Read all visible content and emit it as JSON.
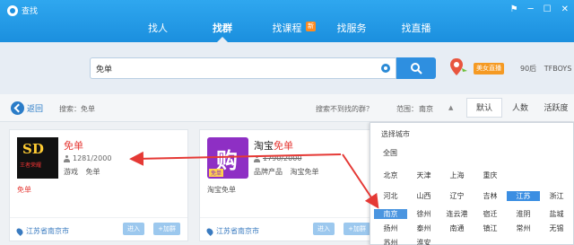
{
  "app": {
    "title": "查找"
  },
  "window_controls": [
    "⚑",
    "─",
    "☐",
    "✕"
  ],
  "nav": {
    "tabs": [
      {
        "label": "找人",
        "active": false
      },
      {
        "label": "找群",
        "active": true
      },
      {
        "label": "找课程",
        "active": false,
        "badge": "新"
      },
      {
        "label": "找服务",
        "active": false
      },
      {
        "label": "找直播",
        "active": false
      }
    ]
  },
  "search": {
    "value": "免单",
    "placeholder": ""
  },
  "header_right": {
    "live_badge": "美女直播",
    "texts": [
      "90后",
      "TFBOYS"
    ]
  },
  "filter": {
    "back_label": "返回",
    "search_keyword": "搜索：免单",
    "not_found_text": "搜索不到找的群？",
    "range_label": "范围：",
    "range_value": "南京",
    "sort_options": [
      {
        "label": "默认",
        "active": true
      },
      {
        "label": "人数",
        "active": false
      },
      {
        "label": "活跃度",
        "active": false
      }
    ]
  },
  "groups": [
    {
      "name_highlight": "免单",
      "name_rest": "",
      "member_count": "1281/2000",
      "tags": [
        "游戏",
        "免单"
      ],
      "description": "免单",
      "location": "江苏省南京市",
      "enter_label": "进入",
      "add_label": "+加群",
      "avatar_text": "SD",
      "avatar_subtext": "王者荣耀"
    },
    {
      "name_highlight": "免单",
      "name_prefix": "淘宝",
      "member_count": "1790/2000",
      "tags": [
        "品牌产品",
        "淘宝免单"
      ],
      "description": "淘宝免单",
      "location": "江苏省南京市",
      "enter_label": "进入",
      "add_label": "+加群",
      "avatar_text": "购",
      "avatar_subtext": "免单"
    }
  ],
  "city_panel": {
    "title": "选择城市",
    "all_label": "全国",
    "rows": [
      [
        "北京",
        "天津",
        "上海",
        "重庆"
      ],
      [
        "河北",
        "山西",
        "辽宁",
        "吉林",
        "江苏",
        "浙江"
      ],
      [
        "南京",
        "徐州",
        "连云港",
        "宿迁",
        "淮阴",
        "盐城"
      ],
      [
        "扬州",
        "泰州",
        "南通",
        "镇江",
        "常州",
        "无锡"
      ],
      [
        "苏州",
        "淮安"
      ]
    ],
    "selected_city": "江苏",
    "highlighted_city": "南京"
  },
  "colors": {
    "primary": "#1b8fde",
    "highlight_red": "#e53935",
    "arrow_red": "#e53935"
  }
}
